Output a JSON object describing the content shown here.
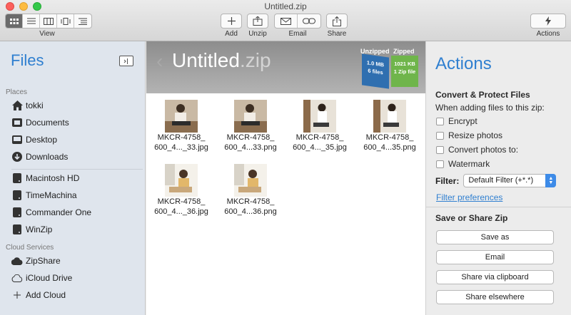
{
  "window": {
    "title": "Untitled.zip"
  },
  "toolbar": {
    "view_label": "View",
    "add_label": "Add",
    "unzip_label": "Unzip",
    "email_label": "Email",
    "share_label": "Share",
    "actions_label": "Actions"
  },
  "sidebar": {
    "title": "Files",
    "places_header": "Places",
    "places": [
      {
        "label": "tokki",
        "icon": "home-icon"
      },
      {
        "label": "Documents",
        "icon": "documents-icon"
      },
      {
        "label": "Desktop",
        "icon": "desktop-icon"
      },
      {
        "label": "Downloads",
        "icon": "downloads-icon"
      }
    ],
    "volumes": [
      {
        "label": "Macintosh HD",
        "icon": "disk-icon"
      },
      {
        "label": "TimeMachina",
        "icon": "disk-icon"
      },
      {
        "label": "Commander One",
        "icon": "disk-icon"
      },
      {
        "label": "WinZip",
        "icon": "disk-icon"
      }
    ],
    "cloud_header": "Cloud Services",
    "cloud": [
      {
        "label": "ZipShare",
        "icon": "cloud-icon"
      },
      {
        "label": "iCloud Drive",
        "icon": "cloud-outline-icon"
      },
      {
        "label": "Add Cloud",
        "icon": "plus-icon"
      }
    ]
  },
  "banner": {
    "name": "Untitled",
    "ext": ".zip",
    "unzipped_header": "Unzipped",
    "zipped_header": "Zipped",
    "unzipped_size": "1.0 MB",
    "unzipped_count": "6 files",
    "zipped_size": "1021 KB",
    "zipped_count": "1 Zip file"
  },
  "files": [
    {
      "line1": "MKCR-4758_",
      "line2": "600_4..._33.jpg"
    },
    {
      "line1": "MKCR-4758_",
      "line2": "600_4...33.png"
    },
    {
      "line1": "MKCR-4758_",
      "line2": "600_4..._35.jpg"
    },
    {
      "line1": "MKCR-4758_",
      "line2": "600_4...35.png"
    },
    {
      "line1": "MKCR-4758_",
      "line2": "600_4..._36.jpg"
    },
    {
      "line1": "MKCR-4758_",
      "line2": "600_4...36.png"
    }
  ],
  "actions": {
    "title": "Actions",
    "convert_header": "Convert & Protect Files",
    "convert_sub": "When adding files to this zip:",
    "options": [
      "Encrypt",
      "Resize photos",
      "Convert photos to:",
      "Watermark"
    ],
    "filter_label": "Filter:",
    "filter_value": "Default Filter (+*.*)",
    "filter_link": "Filter preferences",
    "save_header": "Save or Share Zip",
    "buttons": [
      "Save as",
      "Email",
      "Share via clipboard",
      "Share elsewhere"
    ]
  }
}
